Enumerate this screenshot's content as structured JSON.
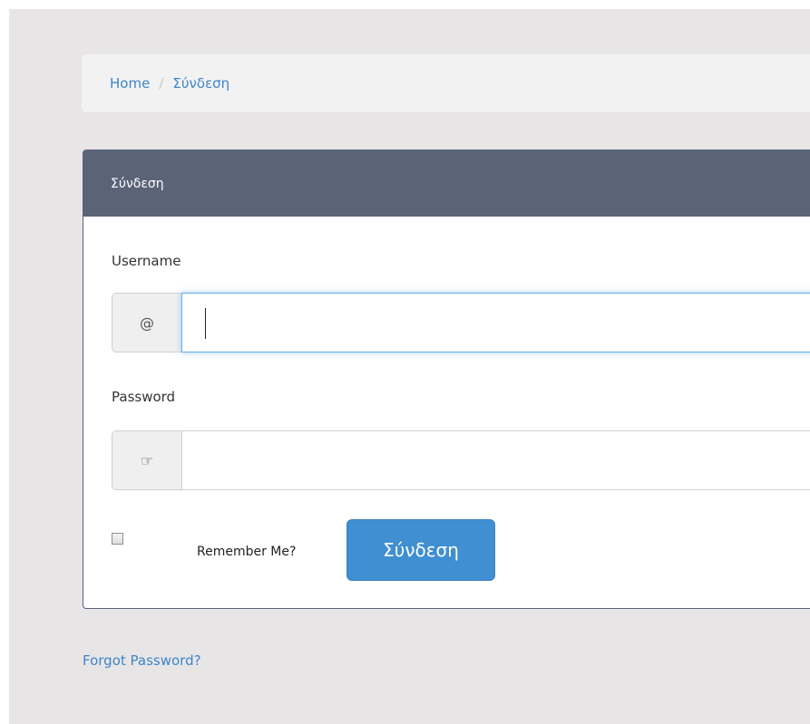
{
  "breadcrumb": {
    "home": "Home",
    "separator": "/",
    "current": "Σύνδεση"
  },
  "panel": {
    "title": "Σύνδεση"
  },
  "form": {
    "username_label": "Username",
    "username_addon": "@",
    "username_value": "",
    "password_label": "Password",
    "password_addon_icon": "hand-pointing-icon",
    "password_addon_glyph": "☞",
    "password_value": "",
    "remember_label": "Remember Me?",
    "remember_checked": false,
    "submit_label": "Σύνδεση"
  },
  "links": {
    "forgot_password": "Forgot Password?"
  },
  "colors": {
    "page_background": "#e8e5e7",
    "panel_header": "#5a6378",
    "link": "#3d86c6",
    "button": "#3f8fd2",
    "focus_border": "#66afe9"
  }
}
